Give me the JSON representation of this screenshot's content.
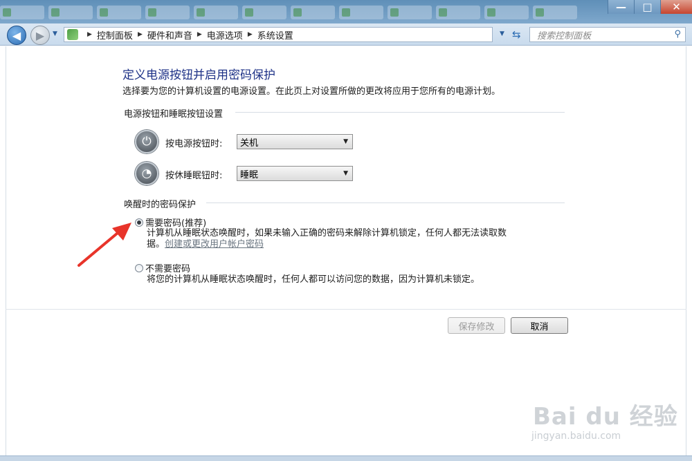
{
  "window": {
    "minimize": "—",
    "maximize": "□",
    "close": "✕"
  },
  "nav": {
    "breadcrumbs": [
      "控制面板",
      "硬件和声音",
      "电源选项",
      "系统设置"
    ],
    "search_placeholder": "搜索控制面板"
  },
  "page": {
    "title": "定义电源按钮并启用密码保护",
    "description": "选择要为您的计算机设置的电源设置。在此页上对设置所做的更改将应用于您所有的电源计划。"
  },
  "power_section": {
    "heading": "电源按钮和睡眠按钮设置",
    "power_button_label": "按电源按钮时:",
    "power_button_value": "关机",
    "sleep_button_label": "按休睡眠钮时:",
    "sleep_button_value": "睡眠"
  },
  "password_section": {
    "heading": "唤醒时的密码保护",
    "require": {
      "label": "需要密码(推荐)",
      "desc_line1": "计算机从睡眠状态唤醒时，如果未输入正确的密码来解除计算机锁定，任何人都无法读取数",
      "desc_line2_prefix": "据。",
      "link": "创建或更改用户帐户密码",
      "checked": true
    },
    "not_require": {
      "label": "不需要密码",
      "desc": "将您的计算机从睡眠状态唤醒时，任何人都可以访问您的数据，因为计算机未锁定。",
      "checked": false
    }
  },
  "buttons": {
    "save": "保存修改",
    "cancel": "取消"
  },
  "watermark": {
    "main": "Bai du 经验",
    "sub": "jingyan.baidu.com"
  },
  "colors": {
    "title": "#1e3287",
    "annotation_arrow": "#e8342a"
  }
}
